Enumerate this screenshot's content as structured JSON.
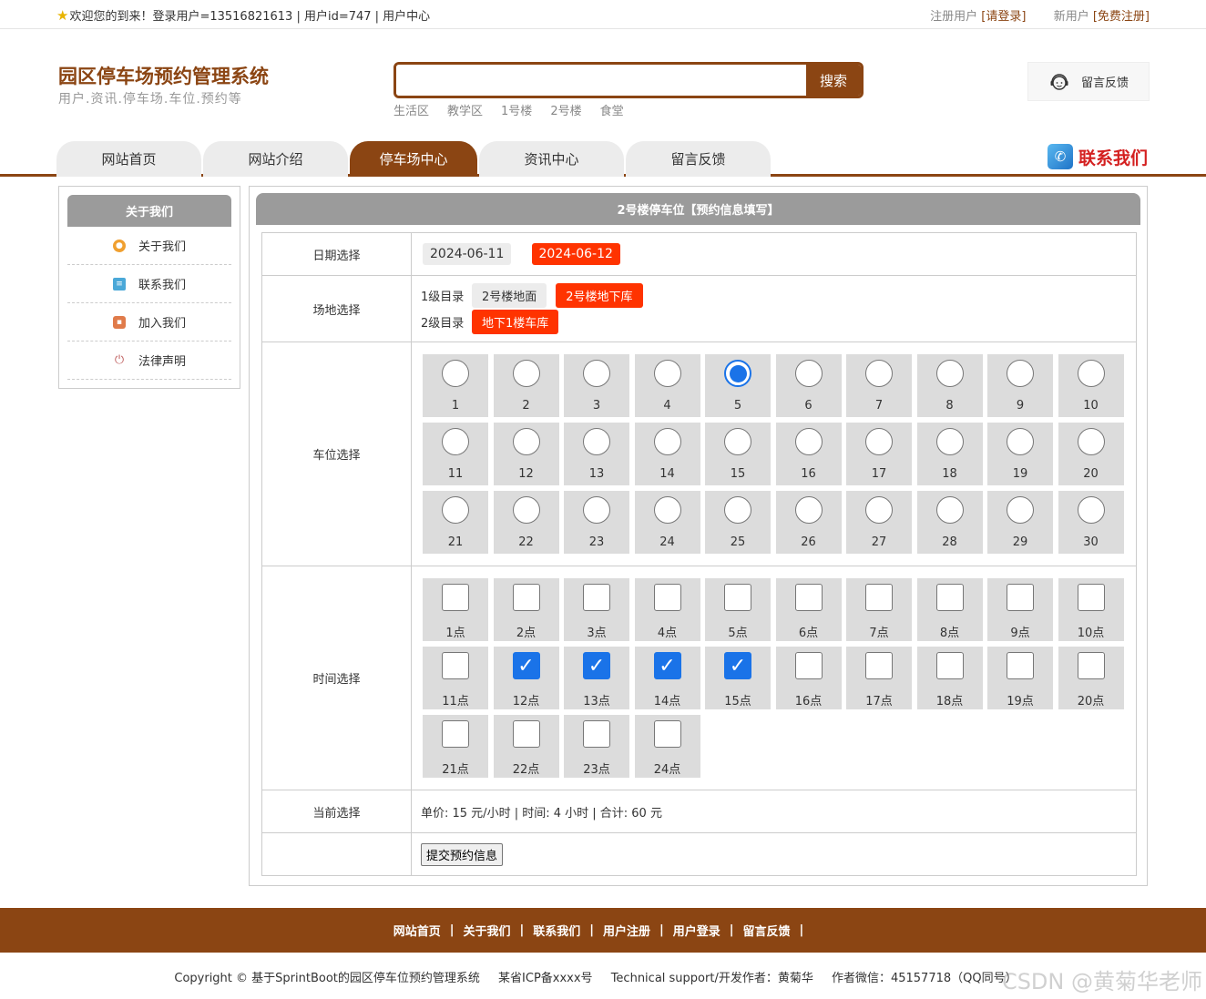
{
  "topbar": {
    "welcome": "欢迎您的到来！登录用户=13516821613 | 用户id=747 | 用户中心",
    "register_label": "注册用户",
    "login_link": "[请登录]",
    "newuser_label": "新用户",
    "register_link": "[免费注册]"
  },
  "header": {
    "title": "园区停车场预约管理系统",
    "subtitle": "用户.资讯.停车场.车位.预约等",
    "search_button": "搜索",
    "search_value": "",
    "hotwords": [
      "生活区",
      "教学区",
      "1号楼",
      "2号楼",
      "食堂"
    ],
    "feedback": "留言反馈"
  },
  "nav": {
    "tabs": [
      "网站首页",
      "网站介绍",
      "停车场中心",
      "资讯中心",
      "留言反馈"
    ],
    "active": "停车场中心",
    "contact": "联系我们"
  },
  "sidebar": {
    "title": "关于我们",
    "items": [
      "关于我们",
      "联系我们",
      "加入我们",
      "法律声明"
    ]
  },
  "main": {
    "title": "2号楼停车位【预约信息填写】",
    "date_label": "日期选择",
    "dates": [
      "2024-06-11",
      "2024-06-12"
    ],
    "selected_date": "2024-06-12",
    "site_label": "场地选择",
    "level1_label": "1级目录",
    "level1_options": [
      "2号楼地面",
      "2号楼地下库"
    ],
    "level1_selected": "2号楼地下库",
    "level2_label": "2级目录",
    "level2_options": [
      "地下1楼车库"
    ],
    "level2_selected": "地下1楼车库",
    "space_label": "车位选择",
    "spaces": [
      "1",
      "2",
      "3",
      "4",
      "5",
      "6",
      "7",
      "8",
      "9",
      "10",
      "11",
      "12",
      "13",
      "14",
      "15",
      "16",
      "17",
      "18",
      "19",
      "20",
      "21",
      "22",
      "23",
      "24",
      "25",
      "26",
      "27",
      "28",
      "29",
      "30"
    ],
    "selected_space": "5",
    "time_label": "时间选择",
    "hours": [
      "1点",
      "2点",
      "3点",
      "4点",
      "5点",
      "6点",
      "7点",
      "8点",
      "9点",
      "10点",
      "11点",
      "12点",
      "13点",
      "14点",
      "15点",
      "16点",
      "17点",
      "18点",
      "19点",
      "20点",
      "21点",
      "22点",
      "23点",
      "24点"
    ],
    "selected_hours": [
      "12点",
      "13点",
      "14点",
      "15点"
    ],
    "current_label": "当前选择",
    "summary": "单价: 15 元/小时 | 时间: 4 小时 | 合计: 60 元",
    "submit_label": "提交预约信息"
  },
  "footer": {
    "links": [
      "网站首页",
      "关于我们",
      "联系我们",
      "用户注册",
      "用户登录",
      "留言反馈"
    ],
    "copyright": "Copyright © 基于SprintBoot的园区停车位预约管理系统",
    "icp": "某省ICP备xxxx号",
    "support": "Technical support/开发作者：黄菊华",
    "wechat": "作者微信：45157718（QQ同号）",
    "watermark": "CSDN @黄菊华老师"
  },
  "colors": {
    "brand": "#8b4513",
    "accent_red": "#ff3300",
    "check_blue": "#1a73e8"
  }
}
